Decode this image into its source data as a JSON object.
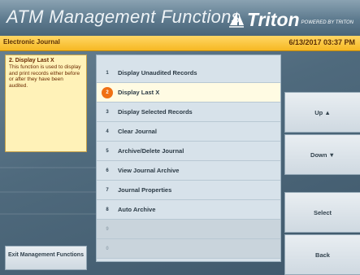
{
  "header": {
    "title": "ATM Management Functions",
    "brand": "Triton",
    "brand_tagline": "POWERED BY TRITON"
  },
  "subbar": {
    "section": "Electronic Journal",
    "datetime": "6/13/2017  03:37 PM"
  },
  "help": {
    "title": "2. Display Last X",
    "text": "This function is used to display and print records either before or after they have been audited."
  },
  "menu": {
    "items": [
      {
        "num": "1",
        "label": "Display Unaudited Records",
        "state": "normal"
      },
      {
        "num": "2",
        "label": "Display Last X",
        "state": "selected"
      },
      {
        "num": "3",
        "label": "Display Selected Records",
        "state": "normal"
      },
      {
        "num": "4",
        "label": "Clear Journal",
        "state": "normal"
      },
      {
        "num": "5",
        "label": "Archive/Delete Journal",
        "state": "normal"
      },
      {
        "num": "6",
        "label": "View Journal Archive",
        "state": "normal"
      },
      {
        "num": "7",
        "label": "Journal Properties",
        "state": "normal"
      },
      {
        "num": "8",
        "label": "Auto Archive",
        "state": "normal"
      },
      {
        "num": "9",
        "label": "",
        "state": "disabled"
      },
      {
        "num": "0",
        "label": "",
        "state": "disabled"
      }
    ]
  },
  "buttons": {
    "up": "Up ▲",
    "down": "Down ▼",
    "select": "Select",
    "back": "Back",
    "exit": "Exit Management Functions"
  },
  "colors": {
    "accent": "#f07014",
    "subbar": "#f6b822",
    "help_bg": "#fff2b8"
  }
}
